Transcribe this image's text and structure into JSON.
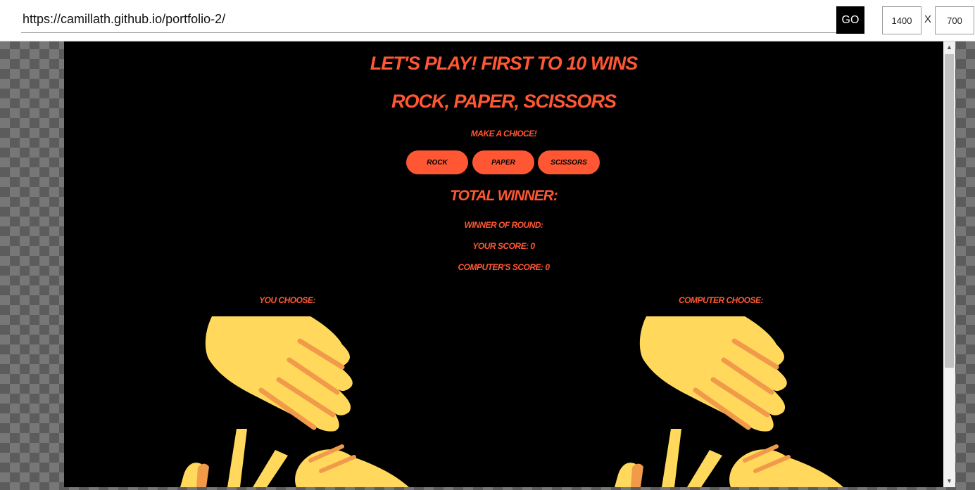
{
  "toolbar": {
    "url": "https://camillath.github.io/portfolio-2/",
    "go_label": "GO",
    "width_value": "1400",
    "x_label": "X",
    "height_value": "700"
  },
  "game": {
    "heading": "Let's play! First to 10 wins",
    "subheading": "Rock, Paper, Scissors",
    "prompt": "Make a chioce!",
    "choices": [
      "Rock",
      "Paper",
      "Scissors"
    ],
    "total_winner": "Total winner:",
    "round_winner": "Winner of round:",
    "your_score": "Your score: 0",
    "computer_score": "Computer's score: 0",
    "player_label": "You choose:",
    "computer_label": "Computer choose:"
  },
  "colors": {
    "accent": "#ff5733",
    "background": "#000000",
    "hand_skin": "#ffd85c",
    "hand_shadow": "#f09a4a"
  },
  "icons": {
    "player_hand": "raised-hand-icon",
    "computer_hand": "raised-hand-icon"
  }
}
